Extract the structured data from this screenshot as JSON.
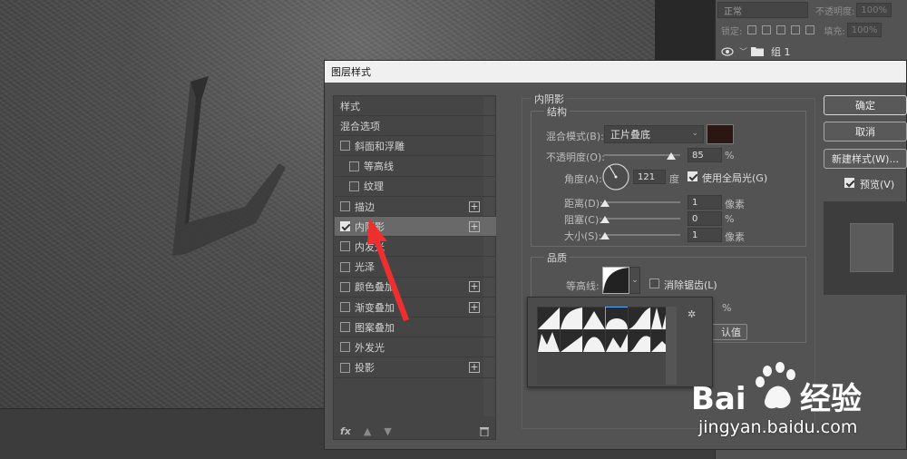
{
  "layers_panel": {
    "blend_mode": "正常",
    "opacity_label": "不透明度:",
    "opacity_value": "100%",
    "lock_label": "锁定:",
    "fill_label": "填充:",
    "fill_value": "100%",
    "group_name": "组 1"
  },
  "dialog": {
    "title": "图层样式",
    "style_list": [
      {
        "label": "样式",
        "checkbox": false,
        "indent": 0,
        "plus": false,
        "checked": false,
        "selected": false
      },
      {
        "label": "混合选项",
        "checkbox": false,
        "indent": 0,
        "plus": false,
        "checked": false,
        "selected": false
      },
      {
        "label": "斜面和浮雕",
        "checkbox": true,
        "indent": 0,
        "plus": false,
        "checked": false,
        "selected": false
      },
      {
        "label": "等高线",
        "checkbox": true,
        "indent": 1,
        "plus": false,
        "checked": false,
        "selected": false
      },
      {
        "label": "纹理",
        "checkbox": true,
        "indent": 1,
        "plus": false,
        "checked": false,
        "selected": false
      },
      {
        "label": "描边",
        "checkbox": true,
        "indent": 0,
        "plus": true,
        "checked": false,
        "selected": false
      },
      {
        "label": "内阴影",
        "checkbox": true,
        "indent": 0,
        "plus": true,
        "checked": true,
        "selected": true
      },
      {
        "label": "内发光",
        "checkbox": true,
        "indent": 0,
        "plus": false,
        "checked": false,
        "selected": false
      },
      {
        "label": "光泽",
        "checkbox": true,
        "indent": 0,
        "plus": false,
        "checked": false,
        "selected": false
      },
      {
        "label": "颜色叠加",
        "checkbox": true,
        "indent": 0,
        "plus": true,
        "checked": false,
        "selected": false
      },
      {
        "label": "渐变叠加",
        "checkbox": true,
        "indent": 0,
        "plus": true,
        "checked": false,
        "selected": false
      },
      {
        "label": "图案叠加",
        "checkbox": true,
        "indent": 0,
        "plus": false,
        "checked": false,
        "selected": false
      },
      {
        "label": "外发光",
        "checkbox": true,
        "indent": 0,
        "plus": false,
        "checked": false,
        "selected": false
      },
      {
        "label": "投影",
        "checkbox": true,
        "indent": 0,
        "plus": true,
        "checked": false,
        "selected": false
      }
    ],
    "footer": {
      "fx": "fx"
    },
    "inner_shadow": {
      "title": "内阴影",
      "structure": {
        "title": "结构",
        "blend_mode_label": "混合模式(B):",
        "blend_mode_value": "正片叠底",
        "shadow_color": "#2a1612",
        "opacity_label": "不透明度(O):",
        "opacity_value": "85",
        "opacity_fraction": 0.85,
        "percent": "%",
        "angle_label": "角度(A):",
        "angle_value": "121",
        "angle_unit": "度",
        "global_light_label": "使用全局光(G)",
        "distance_label": "距离(D):",
        "distance_value": "1",
        "choke_label": "阻塞(C):",
        "choke_value": "0",
        "size_label": "大小(S):",
        "size_value": "1",
        "pixel_unit": "像素"
      },
      "quality": {
        "title": "品质",
        "contour_label": "等高线:",
        "anti_alias_label": "消除锯齿(L)",
        "percent": "%",
        "reset_default_partial": "认值"
      }
    },
    "buttons": {
      "ok": "确定",
      "cancel": "取消",
      "new_style": "新建样式(W)...",
      "preview": "预览(V)"
    }
  },
  "watermark": {
    "url": "jingyan.baidu.com"
  }
}
